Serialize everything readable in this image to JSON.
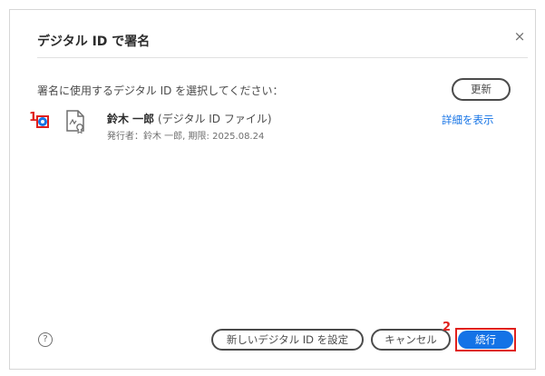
{
  "dialog": {
    "title": "デジタル ID で署名",
    "close_symbol": "×",
    "instruction": "署名に使用するデジタル ID を選択してください：",
    "refresh_label": "更新"
  },
  "digital_id": {
    "name": "鈴木 一郎",
    "type": "(デジタル ID ファイル)",
    "details": "発行者：鈴木 一郎, 期限: 2025.08.24",
    "show_details_label": "詳細を表示",
    "selected": true,
    "icon": "certificate-icon"
  },
  "footer": {
    "help_symbol": "?",
    "configure_new_id_label": "新しいデジタル ID を設定",
    "cancel_label": "キャンセル",
    "continue_label": "続行"
  },
  "annotations": {
    "marker_1": "1",
    "marker_2": "2",
    "highlight_color": "#e0201c"
  },
  "colors": {
    "accent": "#1473e6",
    "text": "#2c2c2c",
    "muted_text": "#6e6e6e"
  }
}
